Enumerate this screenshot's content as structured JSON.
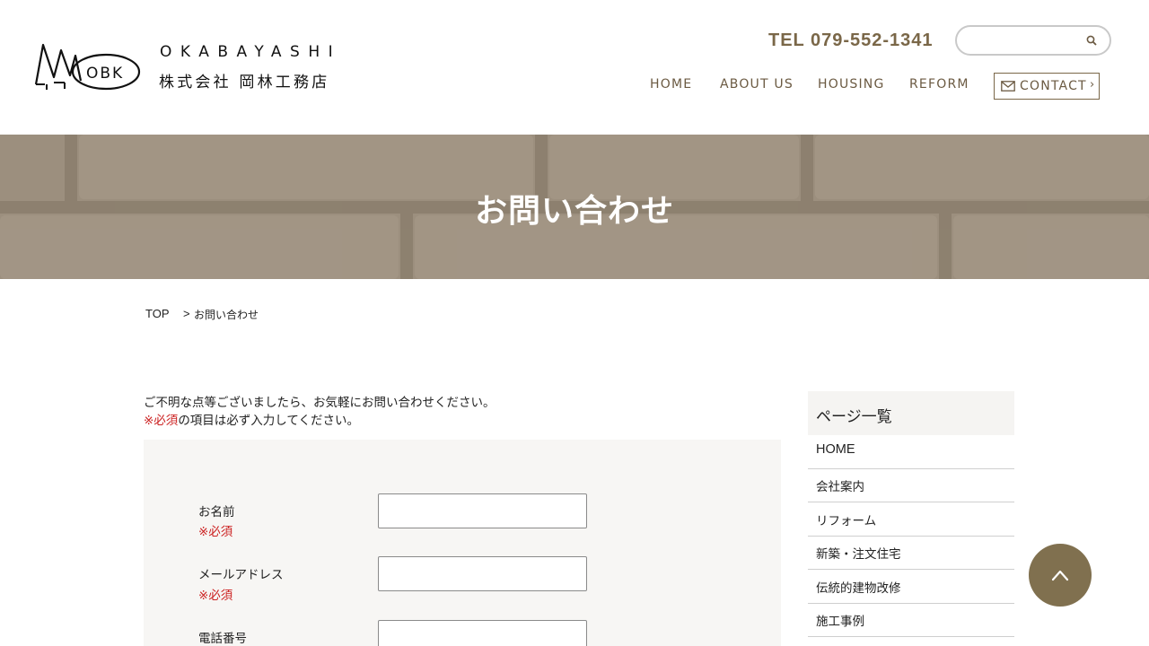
{
  "brand": {
    "name_en": "OKABAYASHI",
    "name_ja": "株式会社 岡林工務店",
    "mark_text": "OBK"
  },
  "header": {
    "tel": "TEL 079-552-1341",
    "search": {
      "value": "",
      "placeholder": "",
      "icon": "search-icon"
    }
  },
  "nav": {
    "items": [
      "HOME",
      "ABOUT US",
      "HOUSING",
      "REFORM"
    ],
    "contact_label": "CONTACT",
    "contact_icon": "mail-icon",
    "contact_chevron": "›"
  },
  "hero": {
    "title": "お問い合わせ"
  },
  "breadcrumb": {
    "top": "TOP",
    "separator": ">",
    "current": "お問い合わせ"
  },
  "intro": {
    "line1": "ご不明な点等ございましたら、お気軽にお問い合わせください。",
    "required_mark": "※必須",
    "line2_rest": "の項目は必ず入力してください。"
  },
  "form": {
    "fields": [
      {
        "label": "お名前",
        "required": "※必須",
        "value": ""
      },
      {
        "label": "メールアドレス",
        "required": "※必須",
        "value": ""
      },
      {
        "label": "電話番号",
        "required": "",
        "value": ""
      }
    ]
  },
  "sidebar": {
    "heading": "ページ一覧",
    "items": [
      "HOME",
      "会社案内",
      "リフォーム",
      "新築・注文住宅",
      "伝統的建物改修",
      "施工事例"
    ]
  },
  "colors": {
    "accent_brown": "#7a6748",
    "hero_bg": "#9c8f7e",
    "required_red": "#cc2222",
    "to_top_bg": "#80704f"
  },
  "to_top": {
    "icon": "chevron-up-icon"
  }
}
